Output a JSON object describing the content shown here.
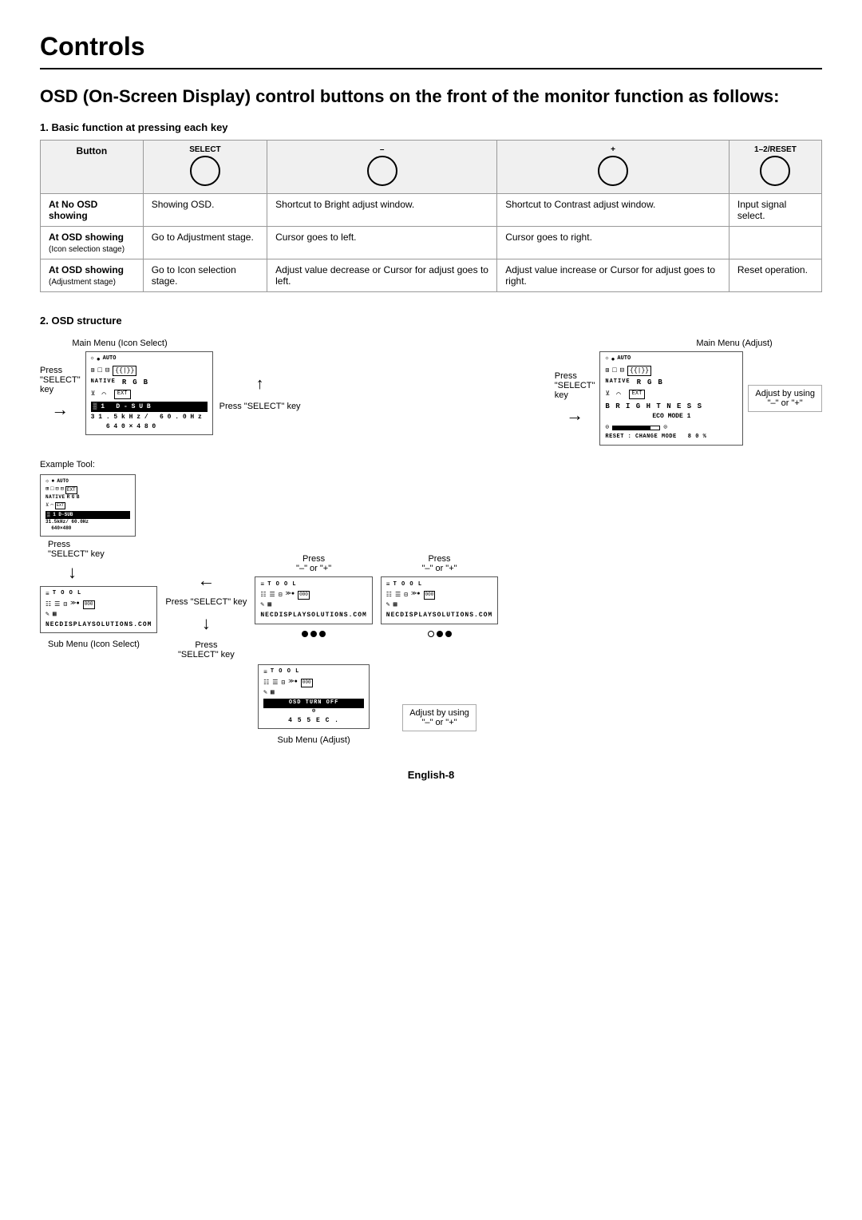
{
  "title": "Controls",
  "subtitle": "OSD (On-Screen Display) control buttons on the front of the monitor function as follows:",
  "section1_title": "1. Basic function at pressing each key",
  "table": {
    "columns": [
      {
        "label": "Button",
        "btn_label": "",
        "btn_symbol": ""
      },
      {
        "label": "SELECT",
        "btn_symbol": "○"
      },
      {
        "label": "–",
        "btn_symbol": "○"
      },
      {
        "label": "+",
        "btn_symbol": "○"
      },
      {
        "label": "1–2/RESET",
        "btn_symbol": "○"
      }
    ],
    "rows": [
      {
        "header": "At No OSD showing",
        "cells": [
          "Showing OSD.",
          "Shortcut to Bright adjust window.",
          "Shortcut to Contrast adjust window.",
          "Input signal select."
        ]
      },
      {
        "header": "At OSD showing",
        "sub_header": "(Icon selection stage)",
        "cells": [
          "Go to Adjustment stage.",
          "Cursor goes to left.",
          "Cursor goes to right.",
          ""
        ]
      },
      {
        "header": "At OSD showing",
        "sub_header": "(Adjustment stage)",
        "cells": [
          "Go to Icon selection stage.",
          "Adjust value decrease or Cursor for adjust goes to left.",
          "Adjust value increase or Cursor for adjust goes to right.",
          "Reset operation."
        ]
      }
    ]
  },
  "section2_title": "2. OSD structure",
  "diagram": {
    "main_menu_icon_select_label": "Main Menu (Icon Select)",
    "main_menu_adjust_label": "Main Menu (Adjust)",
    "press_select_key_label1": "Press\n\"SELECT\"\nkey",
    "press_select_key_label2": "Press\n\"SELECT\"\nkey",
    "press_select_key_bottom": "Press \"SELECT\" key",
    "adjust_by_using_label": "Adjust by using\n\"–\" or \"+\"",
    "example_tool_label": "Example Tool:",
    "sub_menu_icon_select": "Sub Menu (Icon Select)",
    "sub_menu_adjust": "Sub Menu (Adjust)",
    "press_minus_plus1": "Press\n\"–\" or \"+\"",
    "press_minus_plus2": "Press\n\"–\" or \"+\"",
    "press_select_key3": "Press\n\"SELECT\" key",
    "press_select_key4": "Press\n\"SELECT\"\nkey",
    "adjust_by_using_bottom": "Adjust by using\n\"–\" or \"+\""
  },
  "footer": "English-8"
}
